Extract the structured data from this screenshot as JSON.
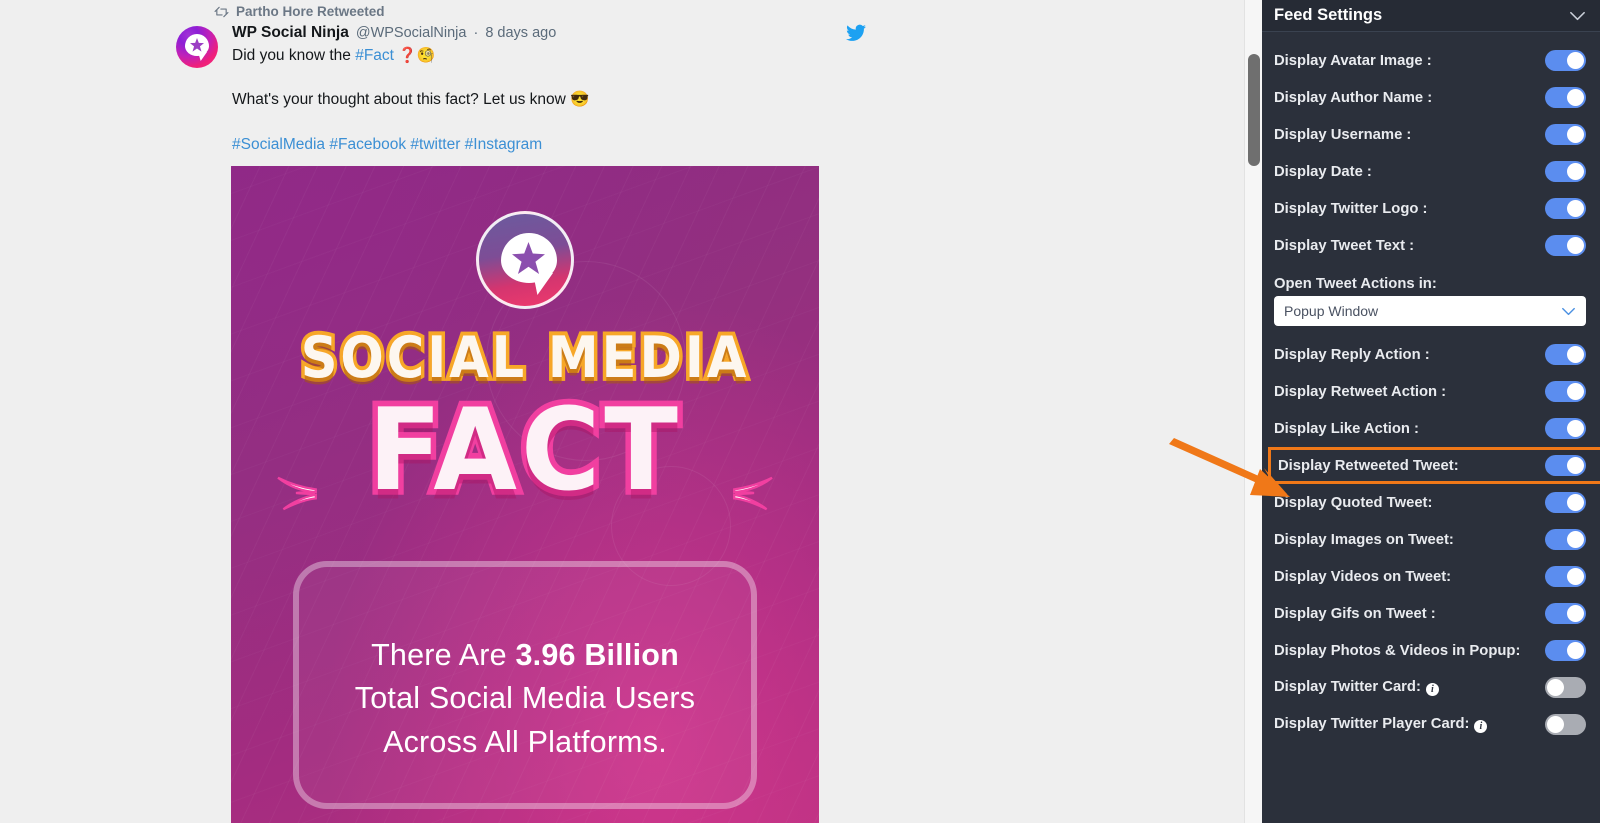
{
  "feed": {
    "retweet_notice": "Partho Hore Retweeted",
    "retweet_icon": "retweet-icon",
    "author_name": "WP Social Ninja",
    "username": "@WPSocialNinja",
    "separator": "·",
    "date": "8 days ago",
    "platform_icon": "twitter-bird-icon",
    "text_line1_pre": "Did you know the ",
    "text_line1_tag": "#Fact",
    "text_line1_post": " ❓🧐",
    "text_line2": "What's your thought about this fact? Let us know 😎",
    "hashtags": [
      "#SocialMedia",
      "#Facebook",
      "#twitter",
      "#Instagram"
    ],
    "image": {
      "brand_logo_icon": "wp-social-ninja-logo-icon",
      "headline_top": "SOCIAL MEDIA",
      "headline_main": "FACT",
      "stat_pre": "There Are ",
      "stat_number": "3.96 Billion",
      "stat_line2": "Total Social Media Users",
      "stat_line3": "Across All Platforms."
    }
  },
  "settings": {
    "title": "Feed Settings",
    "collapse_icon": "chevron-down-icon",
    "select_label": "Open Tweet Actions in:",
    "select_value": "Popup Window",
    "select_icon": "chevron-down-icon",
    "highlight_color": "#f07818",
    "toggle_on_color": "#5b8def",
    "toggle_off_color": "#a9acb3",
    "rows": [
      {
        "label": "Display Avatar Image :",
        "state": "on",
        "name": "display-avatar-image"
      },
      {
        "label": "Display Author Name :",
        "state": "on",
        "name": "display-author-name"
      },
      {
        "label": "Display Username :",
        "state": "on",
        "name": "display-username"
      },
      {
        "label": "Display Date :",
        "state": "on",
        "name": "display-date"
      },
      {
        "label": "Display Twitter Logo :",
        "state": "on",
        "name": "display-twitter-logo"
      },
      {
        "label": "Display Tweet Text :",
        "state": "on",
        "name": "display-tweet-text"
      }
    ],
    "rows_after_select": [
      {
        "label": "Display Reply Action :",
        "state": "on",
        "name": "display-reply-action",
        "highlighted": false,
        "info": false
      },
      {
        "label": "Display Retweet Action :",
        "state": "on",
        "name": "display-retweet-action",
        "highlighted": false,
        "info": false
      },
      {
        "label": "Display Like Action :",
        "state": "on",
        "name": "display-like-action",
        "highlighted": false,
        "info": false
      },
      {
        "label": "Display Retweeted Tweet:",
        "state": "on",
        "name": "display-retweeted-tweet",
        "highlighted": true,
        "info": false
      },
      {
        "label": "Display Quoted Tweet:",
        "state": "on",
        "name": "display-quoted-tweet",
        "highlighted": false,
        "info": false
      },
      {
        "label": "Display Images on Tweet:",
        "state": "on",
        "name": "display-images-on-tweet",
        "highlighted": false,
        "info": false
      },
      {
        "label": "Display Videos on Tweet:",
        "state": "on",
        "name": "display-videos-on-tweet",
        "highlighted": false,
        "info": false
      },
      {
        "label": "Display Gifs on Tweet :",
        "state": "on",
        "name": "display-gifs-on-tweet",
        "highlighted": false,
        "info": false
      },
      {
        "label": "Display Photos & Videos in Popup:",
        "state": "on",
        "name": "display-photos-videos-in-popup",
        "highlighted": false,
        "info": false
      },
      {
        "label": "Display Twitter Card:",
        "state": "off",
        "name": "display-twitter-card",
        "highlighted": false,
        "info": true
      },
      {
        "label": "Display Twitter Player Card:",
        "state": "off",
        "name": "display-twitter-player-card",
        "highlighted": false,
        "info": true
      }
    ]
  },
  "annotation": {
    "arrow_icon": "orange-arrow-icon",
    "color": "#f07818"
  },
  "scrollbar": {
    "name": "vertical-scrollbar"
  }
}
